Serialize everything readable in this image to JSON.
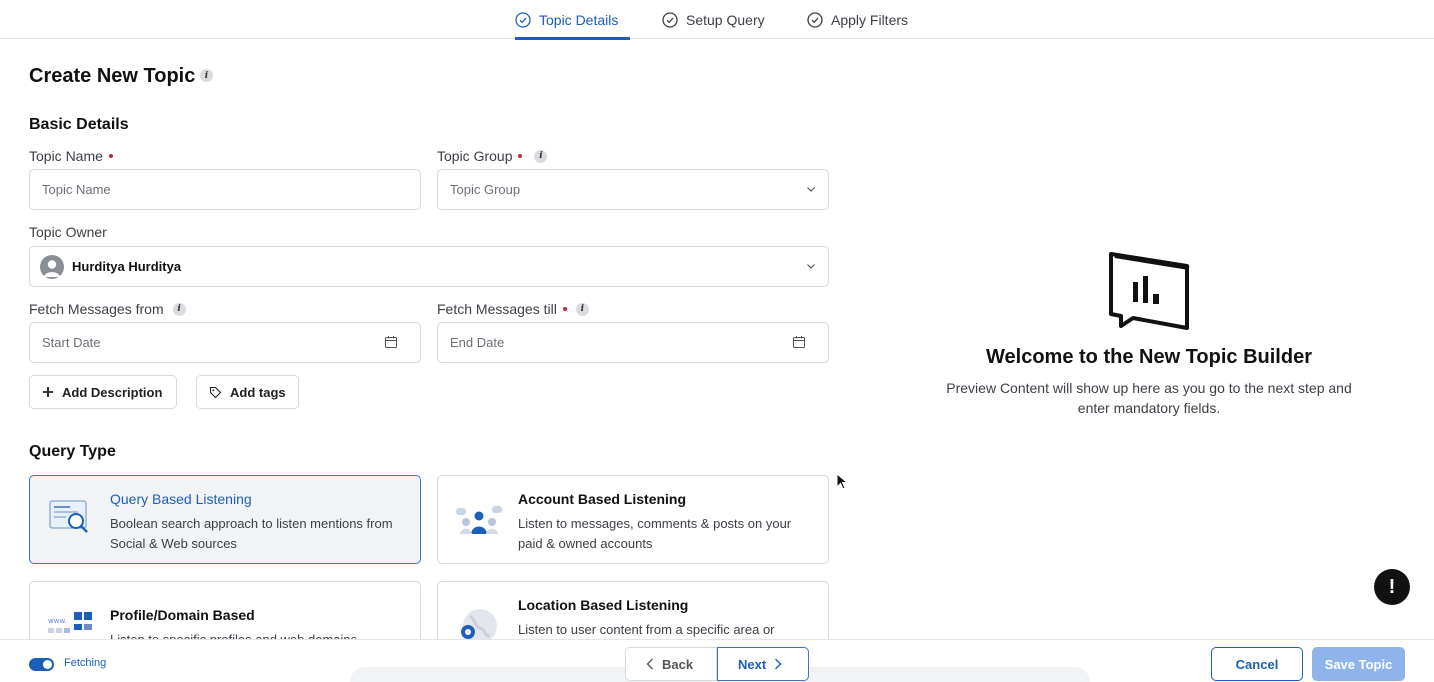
{
  "stepper": {
    "steps": [
      {
        "label": "Topic Details",
        "active": true
      },
      {
        "label": "Setup Query",
        "active": false
      },
      {
        "label": "Apply Filters",
        "active": false
      }
    ]
  },
  "page": {
    "title": "Create New Topic"
  },
  "basic_details": {
    "title": "Basic Details",
    "topic_name": {
      "label": "Topic Name",
      "placeholder": "Topic Name",
      "value": ""
    },
    "topic_group": {
      "label": "Topic Group",
      "placeholder": "Topic Group"
    },
    "topic_owner": {
      "label": "Topic Owner",
      "value": "Hurditya Hurditya"
    },
    "fetch_from": {
      "label": "Fetch Messages from",
      "placeholder": "Start Date"
    },
    "fetch_till": {
      "label": "Fetch Messages till",
      "placeholder": "End Date"
    },
    "add_description": "Add Description",
    "add_tags": "Add tags"
  },
  "query_type": {
    "title": "Query Type",
    "options": [
      {
        "title": "Query Based Listening",
        "desc": "Boolean search approach to listen mentions from Social & Web sources",
        "selected": true
      },
      {
        "title": "Account Based Listening",
        "desc": "Listen to messages, comments & posts on your paid & owned accounts",
        "selected": false
      },
      {
        "title": "Profile/Domain Based",
        "desc": "Listen to specific profiles and web domains",
        "selected": false
      },
      {
        "title": "Location Based Listening",
        "desc": "Listen to user content from a specific area or",
        "selected": false
      }
    ]
  },
  "preview": {
    "title": "Welcome to the New Topic Builder",
    "subtitle": "Preview Content will show up here as you go to the next step and enter mandatory fields."
  },
  "alert_icon": "!",
  "footer": {
    "toggle_label": "Fetching",
    "toggle_on": true,
    "back": "Back",
    "next": "Next",
    "cancel": "Cancel",
    "save": "Save Topic"
  },
  "colors": {
    "accent": "#1c5fb8",
    "required": "#c0273a",
    "save_disabled": "#8fb4ec"
  }
}
